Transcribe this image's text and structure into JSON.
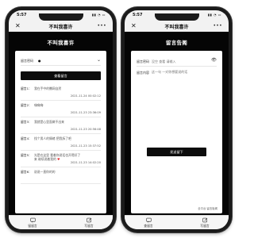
{
  "left_phone": {
    "status": {
      "time": "5:57",
      "signal": "▮▮ ◔ ▭"
    },
    "nav": {
      "close": "✕",
      "title": "不叫我喜许",
      "more": "•••"
    },
    "heading": "不叫我喜许",
    "select": {
      "label": "留言密码",
      "value": "●",
      "chevron": "⌄"
    },
    "view_button": "查看留言",
    "entries": [
      {
        "no": "留言1：",
        "line1": "我在手中的撒网自然",
        "line2": "",
        "time": "2021-11-24 00:02:12"
      },
      {
        "no": "留言2：",
        "line1": "嗨嗨嗨",
        "line2": "",
        "time": "2021-11-23 23:36:09"
      },
      {
        "no": "留言3：",
        "line1": "我就是心里面做不出来",
        "line2": "",
        "time": "2021-11-23 20:56:48"
      },
      {
        "no": "留言4：",
        "line1": "找个男人的情绪 把我拆了吧",
        "line2": "",
        "time": "2021-11-23 15:37:52"
      },
      {
        "no": "留言5：",
        "line1": "光是在这里 看着你说话也开得好了",
        "line2": "来 继续说着我的",
        "time": "2021-11-23 14:02:20"
      },
      {
        "no": "留言6：",
        "line1": "说说一直你的的",
        "line2": "",
        "time": ""
      }
    ],
    "tabs": [
      {
        "label": "留留言"
      },
      {
        "label": "写留言"
      }
    ]
  },
  "right_phone": {
    "status": {
      "time": "5:57",
      "signal": "▮▮ ◔ ▭"
    },
    "nav": {
      "close": "✕",
      "title": "不叫我喜许",
      "more": "•••"
    },
    "heading": "留言告阁",
    "password_field": {
      "label": "留言密码",
      "placeholder": "没空 查看 请输入"
    },
    "content_field": {
      "label": "留言内容",
      "placeholder": "这一句 一对你想要说的话"
    },
    "send_button": "发送留下",
    "footnote": "全平台 留言板阁",
    "tabs": [
      {
        "label": "查留言"
      },
      {
        "label": "写留言"
      }
    ]
  },
  "colors": {
    "dark": "#050505",
    "card": "#ffffff",
    "heart": "#e0262a"
  },
  "icons": [
    "close-icon",
    "more-icon",
    "chevron-down-icon",
    "eye-icon",
    "message-icon",
    "edit-icon"
  ]
}
